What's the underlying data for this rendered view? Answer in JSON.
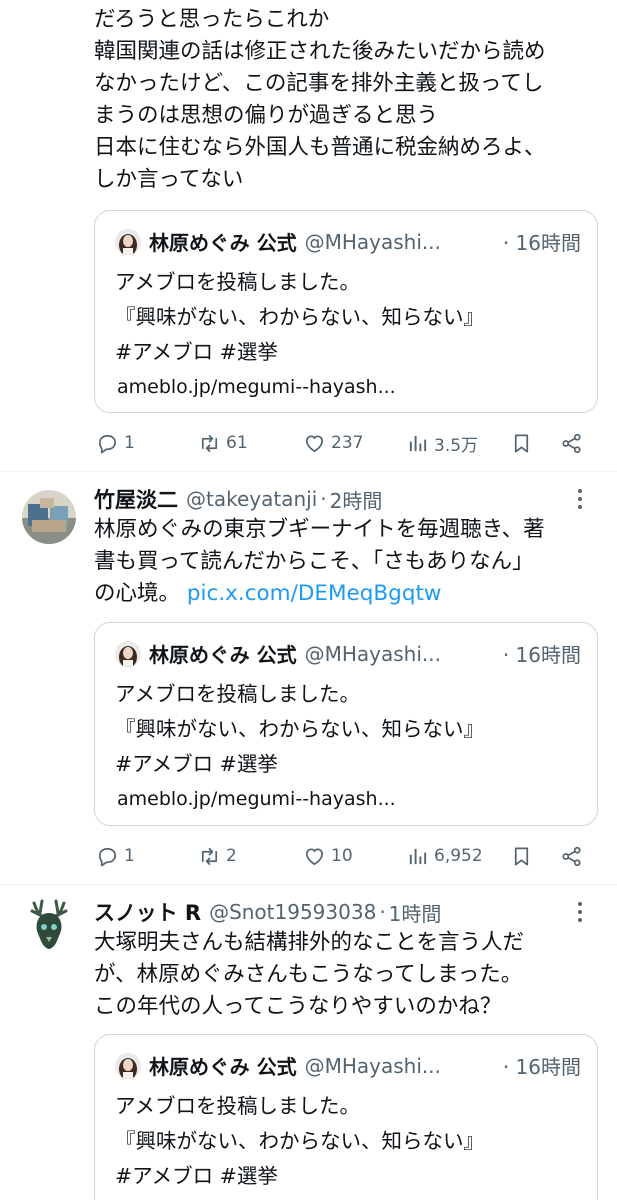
{
  "tweets": [
    {
      "lines": [
        "だろうと思ったらこれか",
        "韓国関連の話は修正された後みたいだから読め",
        "なかったけど、この記事を排外主義と扱ってし",
        "まうのは思想の偏りが過ぎると思う",
        "日本に住むなら外国人も普通に税金納めろよ、",
        "しか言ってない"
      ],
      "quote": {
        "name": "林原めぐみ 公式",
        "handle": "@MHayashi...",
        "time": "16時間",
        "line1": "アメブロを投稿しました。",
        "line2": "『興味がない、わからない、知らない』",
        "line3": "#アメブロ #選挙",
        "url": "ameblo.jp/megumi--hayash..."
      },
      "stats": {
        "replies": "1",
        "retweets": "61",
        "likes": "237",
        "views": "3.5万"
      }
    },
    {
      "name": "竹屋淡二",
      "handle": "@takeyatanji",
      "time": "2時間",
      "line1": "林原めぐみの東京ブギーナイトを毎週聴き、著",
      "line2": "書も買って読んだからこそ、「さもありなん」",
      "line3_prefix": "の心境。",
      "link": "pic.x.com/DEMeqBgqtw",
      "quote": {
        "name": "林原めぐみ 公式",
        "handle": "@MHayashi...",
        "time": "16時間",
        "line1": "アメブロを投稿しました。",
        "line2": "『興味がない、わからない、知らない』",
        "line3": "#アメブロ #選挙",
        "url": "ameblo.jp/megumi--hayash..."
      },
      "stats": {
        "replies": "1",
        "retweets": "2",
        "likes": "10",
        "views": "6,952"
      }
    },
    {
      "name": "スノット R",
      "handle": "@Snot19593038",
      "time": "1時間",
      "lines": [
        "大塚明夫さんも結構排外的なことを言う人だ",
        "が、林原めぐみさんもこうなってしまった。",
        "この年代の人ってこうなりやすいのかね？"
      ],
      "quote": {
        "name": "林原めぐみ 公式",
        "handle": "@MHayashi...",
        "time": "16時間",
        "line1": "アメブロを投稿しました。",
        "line2": "『興味がない、わからない、知らない』",
        "line3": "#アメブロ #選挙"
      }
    }
  ],
  "separator": "·",
  "colors": {
    "text": "#0f1419",
    "muted": "#536471",
    "link": "#1d9bf0",
    "border": "#cfd9de"
  },
  "icons": [
    "reply-icon",
    "retweet-icon",
    "like-icon",
    "views-icon",
    "bookmark-icon",
    "share-icon",
    "more-icon"
  ]
}
